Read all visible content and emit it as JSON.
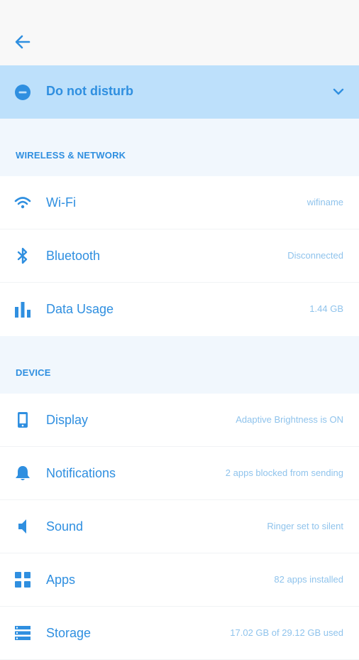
{
  "header": {
    "back_icon": "arrow-left-icon"
  },
  "dnd": {
    "label": "Do not disturb",
    "icon": "minus-circle-icon",
    "chevron_icon": "chevron-down-icon"
  },
  "sections": [
    {
      "title": "WIRELESS & NETWORK",
      "items": [
        {
          "label": "Wi-Fi",
          "value": "wifiname",
          "icon": "wifi-icon"
        },
        {
          "label": "Bluetooth",
          "value": "Disconnected",
          "icon": "bluetooth-icon"
        },
        {
          "label": "Data Usage",
          "value": "1.44 GB",
          "icon": "bar-chart-icon"
        }
      ]
    },
    {
      "title": "DEVICE",
      "items": [
        {
          "label": "Display",
          "value": "Adaptive Brightness is ON",
          "icon": "phone-icon"
        },
        {
          "label": "Notifications",
          "value": "2 apps blocked from sending",
          "icon": "bell-icon"
        },
        {
          "label": "Sound",
          "value": "Ringer set to silent",
          "icon": "speaker-icon"
        },
        {
          "label": "Apps",
          "value": "82 apps installed",
          "icon": "grid-icon"
        },
        {
          "label": "Storage",
          "value": "17.02 GB of 29.12 GB used",
          "icon": "storage-icon"
        }
      ]
    }
  ],
  "colors": {
    "accent": "#2f8fe0",
    "dnd_background": "#bde0fb",
    "section_background": "#f1f7fd",
    "value_text": "#8fc3ec"
  }
}
